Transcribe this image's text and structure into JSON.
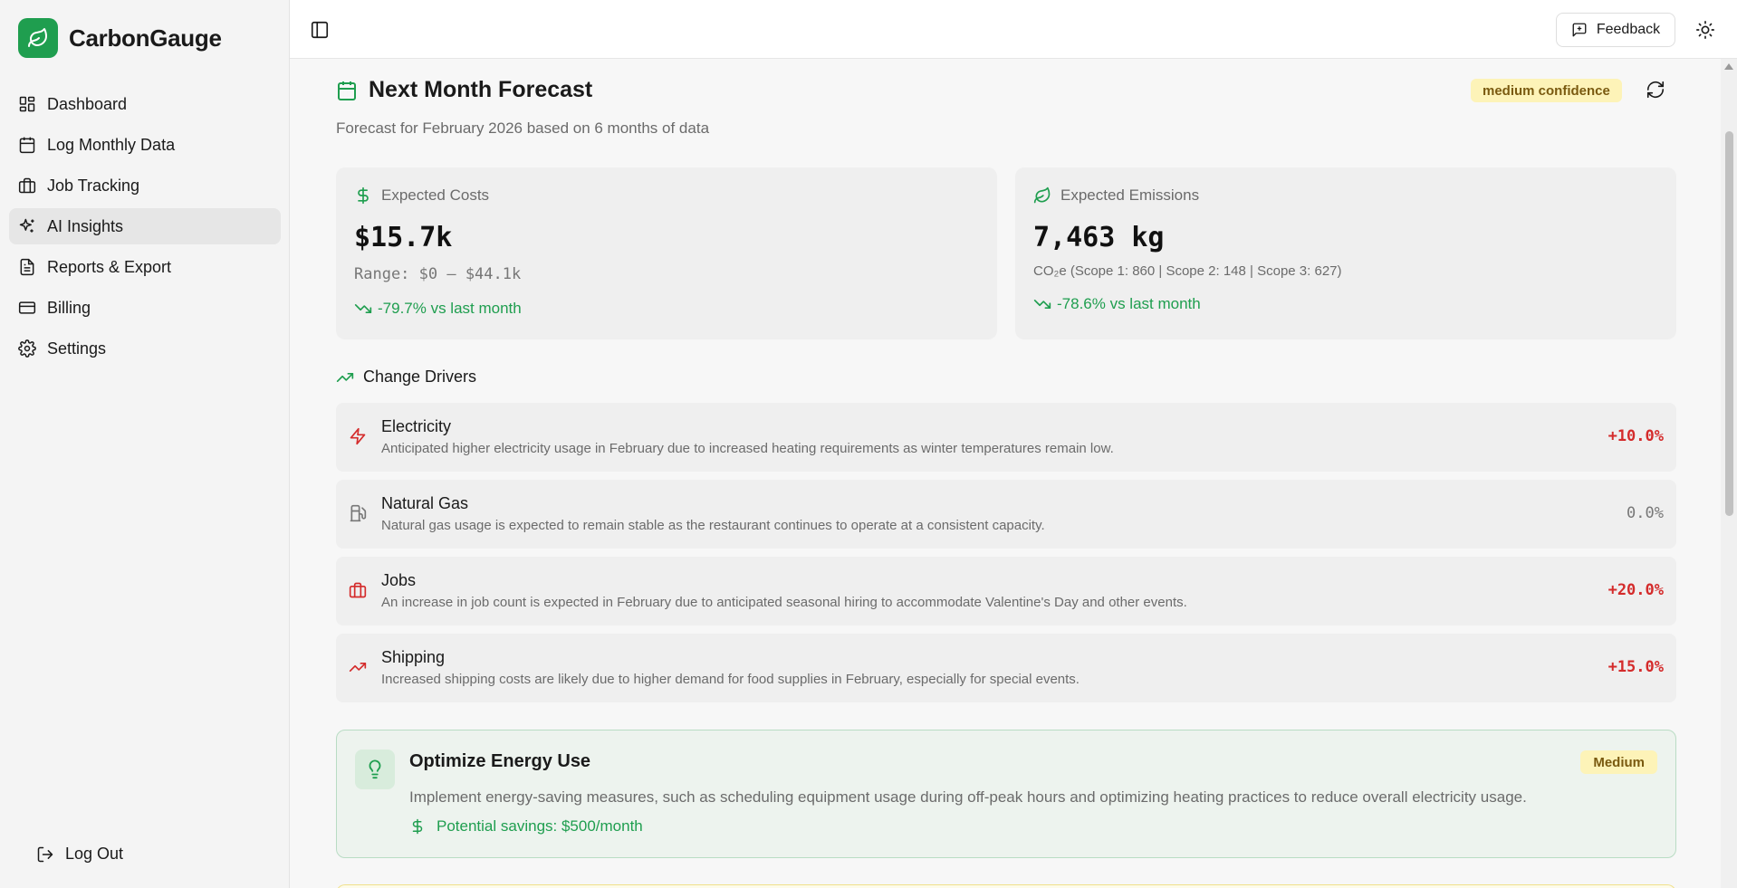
{
  "brand": {
    "name": "CarbonGauge"
  },
  "sidebar": {
    "items": [
      {
        "label": "Dashboard",
        "icon": "dashboard-icon"
      },
      {
        "label": "Log Monthly Data",
        "icon": "calendar-icon"
      },
      {
        "label": "Job Tracking",
        "icon": "briefcase-icon"
      },
      {
        "label": "AI Insights",
        "icon": "sparkles-icon",
        "active": true
      },
      {
        "label": "Reports & Export",
        "icon": "file-text-icon"
      },
      {
        "label": "Billing",
        "icon": "credit-card-icon"
      },
      {
        "label": "Settings",
        "icon": "gear-icon"
      }
    ],
    "logout_label": "Log Out"
  },
  "topbar": {
    "feedback_label": "Feedback"
  },
  "forecast": {
    "title": "Next Month Forecast",
    "confidence": "medium confidence",
    "subtitle": "Forecast for February 2026 based on 6 months of data",
    "costs": {
      "label": "Expected Costs",
      "value": "$15.7k",
      "range": "Range: $0 – $44.1k",
      "trend": "-79.7% vs last month"
    },
    "emissions": {
      "label": "Expected Emissions",
      "value": "7,463 kg",
      "detail": "CO₂e (Scope 1: 860 | Scope 2: 148 | Scope 3: 627)",
      "trend": "-78.6% vs last month"
    }
  },
  "drivers": {
    "title": "Change Drivers",
    "items": [
      {
        "name": "Electricity",
        "icon": "zap-icon",
        "desc": "Anticipated higher electricity usage in February due to increased heating requirements as winter temperatures remain low.",
        "change": "+10.0%",
        "tone": "pos",
        "color": "#d42b2b"
      },
      {
        "name": "Natural Gas",
        "icon": "fuel-icon",
        "desc": "Natural gas usage is expected to remain stable as the restaurant continues to operate at a consistent capacity.",
        "change": "0.0%",
        "tone": "neu",
        "color": "#777777"
      },
      {
        "name": "Jobs",
        "icon": "briefcase-icon",
        "desc": "An increase in job count is expected in February due to anticipated seasonal hiring to accommodate Valentine's Day and other events.",
        "change": "+20.0%",
        "tone": "pos",
        "color": "#d42b2b"
      },
      {
        "name": "Shipping",
        "icon": "trending-up-icon",
        "desc": "Increased shipping costs are likely due to higher demand for food supplies in February, especially for special events.",
        "change": "+15.0%",
        "tone": "pos",
        "color": "#d42b2b"
      }
    ]
  },
  "recommendation": {
    "title": "Optimize Energy Use",
    "priority": "Medium",
    "desc": "Implement energy-saving measures, such as scheduling equipment usage during off-peak hours and optimizing heating practices to reduce overall electricity usage.",
    "savings": "Potential savings: $500/month"
  },
  "colors": {
    "brand": "#1f9e4f",
    "accent_green": "#1f9e4f",
    "negative_red": "#d42b2b",
    "badge_yellow": "#fdf3b8"
  }
}
